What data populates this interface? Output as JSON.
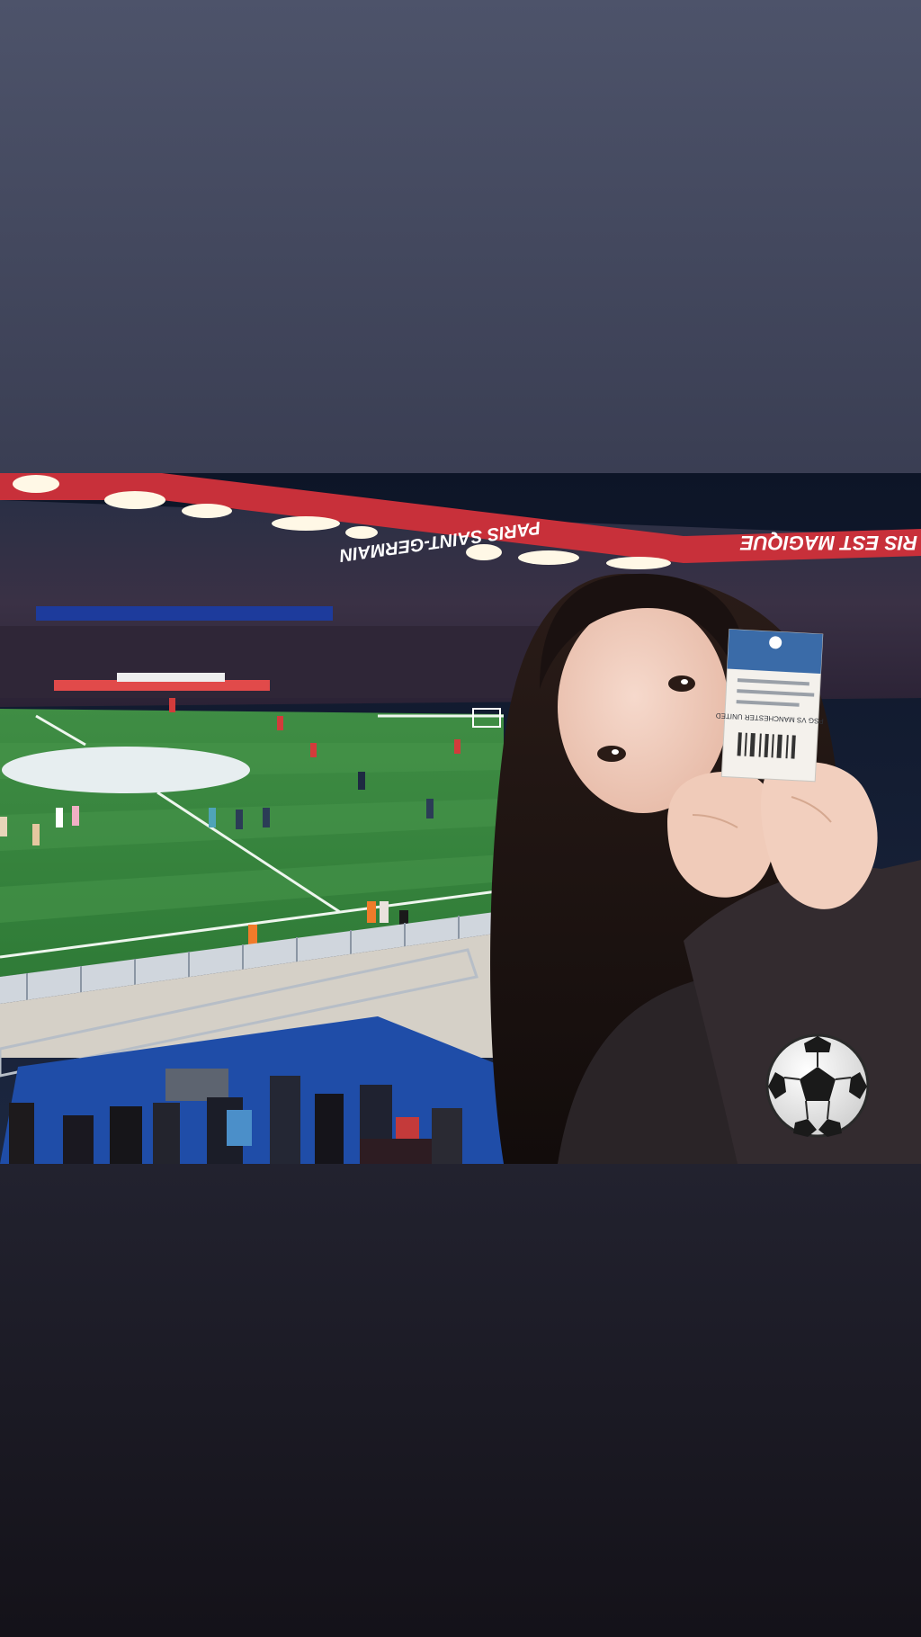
{
  "story": {
    "background_top_color": "#4d536a",
    "background_bottom_color": "#141219"
  },
  "photo": {
    "banner": {
      "club_text": "PARIS SAINT-GERMAIN",
      "slogan_text": "RIS EST MAGIQUE"
    },
    "ticket": {
      "match_text": "PSG VS MANCHESTER UNITED"
    }
  },
  "sticker": {
    "icon": "soccer-ball-icon"
  }
}
